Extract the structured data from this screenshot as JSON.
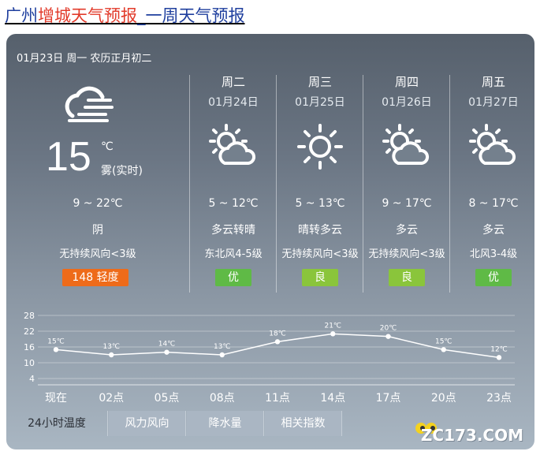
{
  "title": {
    "part1": "广州",
    "part2": "增城天气预报",
    "part3": "_一周天气预报"
  },
  "date_line": "01月23日 周一 农历正月初二",
  "today": {
    "temp": "15",
    "unit": "℃",
    "status": "雾(实时)",
    "range": "9 ~ 22℃",
    "weather": "阴",
    "wind": "无持续风向<3级",
    "aqi": "148 轻度",
    "icon": "overcast-cloud-icon"
  },
  "days": [
    {
      "name": "周二",
      "date": "01月24日",
      "range": "5 ~ 12℃",
      "weather": "多云转晴",
      "wind": "东北风4-5级",
      "aqi": "优",
      "aqi_color": "#5fba46",
      "icon": "partly-cloudy-icon"
    },
    {
      "name": "周三",
      "date": "01月25日",
      "range": "5 ~ 13℃",
      "weather": "晴转多云",
      "wind": "无持续风向<3级",
      "aqi": "良",
      "aqi_color": "#8ac53b",
      "icon": "sunny-icon"
    },
    {
      "name": "周四",
      "date": "01月26日",
      "range": "9 ~ 17℃",
      "weather": "多云",
      "wind": "无持续风向<3级",
      "aqi": "良",
      "aqi_color": "#8ac53b",
      "icon": "partly-cloudy-icon"
    },
    {
      "name": "周五",
      "date": "01月27日",
      "range": "8 ~ 17℃",
      "weather": "多云",
      "wind": "北风3-4级",
      "aqi": "优",
      "aqi_color": "#5fba46",
      "icon": "partly-cloudy-icon"
    }
  ],
  "tabs": [
    "24小时温度",
    "风力风向",
    "降水量",
    "相关指数"
  ],
  "watermark": "ZC173.COM",
  "chart_data": {
    "type": "line",
    "categories": [
      "现在",
      "02点",
      "05点",
      "08点",
      "11点",
      "14点",
      "17点",
      "20点",
      "23点"
    ],
    "values": [
      15,
      13,
      14,
      13,
      18,
      21,
      20,
      15,
      12
    ],
    "point_labels": [
      "15℃",
      "13℃",
      "14℃",
      "13℃",
      "18℃",
      "21℃",
      "20℃",
      "15℃",
      "12℃"
    ],
    "yticks": [
      4,
      10,
      16,
      22,
      28
    ],
    "ylim": [
      4,
      28
    ],
    "grid": true
  }
}
